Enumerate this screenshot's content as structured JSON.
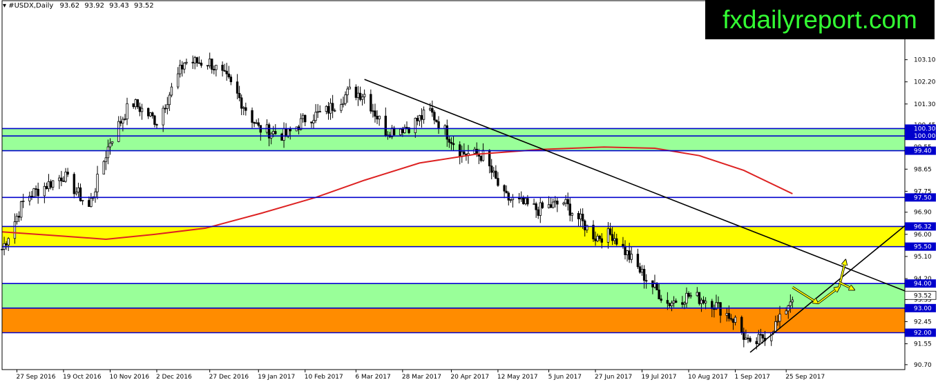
{
  "header": {
    "symbol": "#USDX,Daily",
    "quotes": [
      "93.62",
      "93.92",
      "93.43",
      "93.52"
    ]
  },
  "brand": {
    "text": "fxdailyreport.com"
  },
  "colors": {
    "green_zone": "#99ff99",
    "yellow_zone": "#ffff00",
    "orange_zone": "#ff8c00",
    "level_line": "#0000cc",
    "moving_average": "#dd2222",
    "candle_up": "#ffffff",
    "candle_down": "#000000",
    "trendline": "#000000",
    "arrow": "#ffff00",
    "price_tag": "#000080"
  },
  "chart_data": {
    "type": "candlestick",
    "title": "",
    "ylim": [
      90.5,
      105.5
    ],
    "y_ticks": [
      "103.10",
      "102.20",
      "101.30",
      "100.45",
      "99.55",
      "98.65",
      "97.75",
      "96.90",
      "96.00",
      "95.10",
      "94.20",
      "93.35",
      "92.45",
      "91.55",
      "90.70"
    ],
    "x_ticks": [
      "27 Sep 2016",
      "19 Oct 2016",
      "10 Nov 2016",
      "2 Dec 2016",
      "27 Dec 2016",
      "19 Jan 2017",
      "10 Feb 2017",
      "6 Mar 2017",
      "28 Mar 2017",
      "20 Apr 2017",
      "12 May 2017",
      "5 Jun 2017",
      "27 Jun 2017",
      "19 Jul 2017",
      "10 Aug 2017",
      "1 Sep 2017",
      "25 Sep 2017"
    ],
    "x_range": [
      "2016-09-20",
      "2017-11-20"
    ],
    "levels": [
      "100.30",
      "100.00",
      "99.40",
      "97.50",
      "96.32",
      "95.50",
      "94.00",
      "93.00",
      "92.00"
    ],
    "current_price": "93.52",
    "zones": [
      {
        "color": "green",
        "from": 99.4,
        "to": 100.3
      },
      {
        "color": "yellow",
        "from": 95.5,
        "to": 96.32
      },
      {
        "color": "green",
        "from": 93.0,
        "to": 94.0
      },
      {
        "color": "orange",
        "from": 92.0,
        "to": 93.0
      }
    ],
    "trendlines": [
      {
        "from": [
          "2017-03-10",
          102.3
        ],
        "to": [
          "2017-11-20",
          93.7
        ]
      },
      {
        "from": [
          "2017-09-08",
          91.2
        ],
        "to": [
          "2017-11-20",
          96.35
        ]
      }
    ],
    "moving_average": [
      [
        "2016-09-20",
        96.1
      ],
      [
        "2016-10-15",
        95.95
      ],
      [
        "2016-11-08",
        95.8
      ],
      [
        "2016-12-01",
        96.0
      ],
      [
        "2016-12-25",
        96.25
      ],
      [
        "2017-01-20",
        96.85
      ],
      [
        "2017-02-15",
        97.5
      ],
      [
        "2017-03-10",
        98.2
      ],
      [
        "2017-04-05",
        98.9
      ],
      [
        "2017-05-01",
        99.25
      ],
      [
        "2017-06-01",
        99.45
      ],
      [
        "2017-07-01",
        99.55
      ],
      [
        "2017-07-25",
        99.5
      ],
      [
        "2017-08-15",
        99.2
      ],
      [
        "2017-09-05",
        98.6
      ],
      [
        "2017-09-28",
        97.65
      ]
    ],
    "arrows": [
      {
        "from": [
          "2017-09-28",
          93.85
        ],
        "to": [
          "2017-10-10",
          93.2
        ]
      },
      {
        "from": [
          "2017-10-10",
          93.2
        ],
        "to": [
          "2017-10-20",
          93.85
        ]
      },
      {
        "from": [
          "2017-10-20",
          93.85
        ],
        "to": [
          "2017-10-23",
          94.95
        ]
      },
      {
        "from": [
          "2017-10-20",
          94.05
        ],
        "to": [
          "2017-10-27",
          93.75
        ]
      }
    ],
    "candles_anchor": [
      [
        "2016-09-20",
        95.4
      ],
      [
        "2016-10-01",
        97.5
      ],
      [
        "2016-10-19",
        98.4
      ],
      [
        "2016-10-31",
        97.1
      ],
      [
        "2016-11-10",
        99.8
      ],
      [
        "2016-11-20",
        101.4
      ],
      [
        "2016-12-02",
        100.6
      ],
      [
        "2016-12-15",
        103.0
      ],
      [
        "2016-12-27",
        103.0
      ],
      [
        "2017-01-05",
        102.2
      ],
      [
        "2017-01-19",
        100.3
      ],
      [
        "2017-02-01",
        100.0
      ],
      [
        "2017-02-10",
        100.7
      ],
      [
        "2017-02-20",
        101.0
      ],
      [
        "2017-03-03",
        101.8
      ],
      [
        "2017-03-10",
        101.7
      ],
      [
        "2017-03-20",
        100.2
      ],
      [
        "2017-03-31",
        100.4
      ],
      [
        "2017-04-10",
        101.0
      ],
      [
        "2017-04-25",
        99.3
      ],
      [
        "2017-05-05",
        99.2
      ],
      [
        "2017-05-15",
        97.5
      ],
      [
        "2017-05-31",
        97.0
      ],
      [
        "2017-06-12",
        97.3
      ],
      [
        "2017-06-27",
        95.9
      ],
      [
        "2017-07-05",
        96.0
      ],
      [
        "2017-07-19",
        94.4
      ],
      [
        "2017-07-31",
        93.2
      ],
      [
        "2017-08-10",
        93.5
      ],
      [
        "2017-08-20",
        93.3
      ],
      [
        "2017-09-01",
        92.5
      ],
      [
        "2017-09-08",
        91.4
      ],
      [
        "2017-09-15",
        91.9
      ],
      [
        "2017-09-22",
        92.5
      ],
      [
        "2017-09-28",
        93.52
      ]
    ]
  }
}
